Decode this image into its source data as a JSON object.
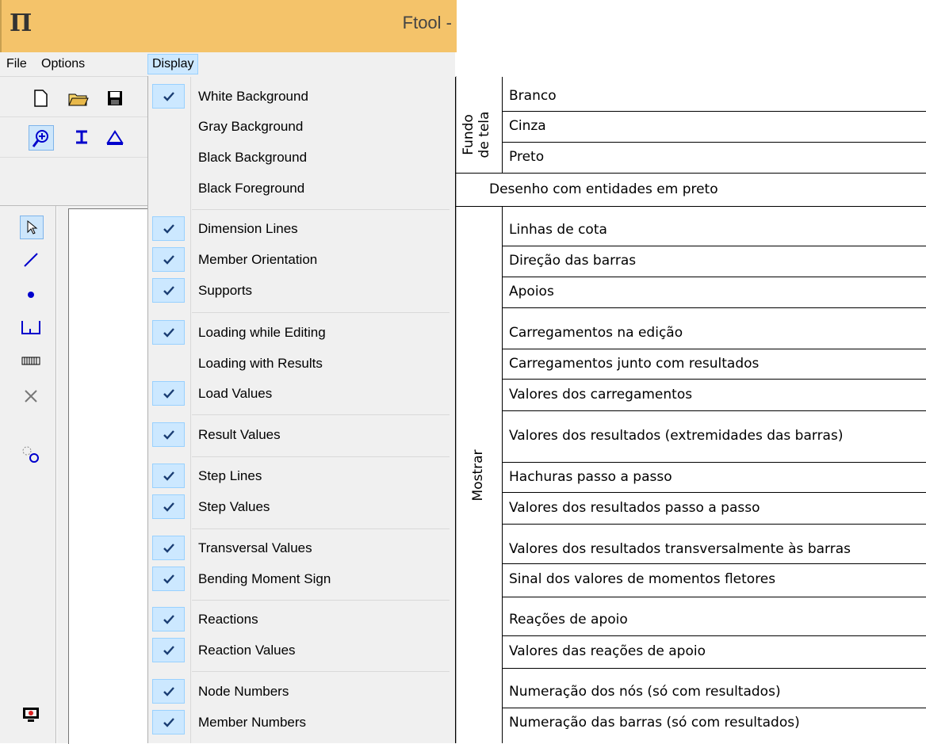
{
  "window": {
    "title": "Ftool -"
  },
  "menubar": {
    "file": "File",
    "options": "Options",
    "display": "Display"
  },
  "display_menu": {
    "items": [
      {
        "label": "White Background",
        "checked": true
      },
      {
        "label": "Gray Background",
        "checked": false
      },
      {
        "label": "Black Background",
        "checked": false
      },
      {
        "label": "Black Foreground",
        "checked": false
      },
      {
        "label": "Dimension Lines",
        "checked": true
      },
      {
        "label": "Member Orientation",
        "checked": true
      },
      {
        "label": "Supports",
        "checked": true
      },
      {
        "label": "Loading while Editing",
        "checked": true
      },
      {
        "label": "Loading with Results",
        "checked": false
      },
      {
        "label": "Load Values",
        "checked": true
      },
      {
        "label": "Result Values",
        "checked": true
      },
      {
        "label": "Step Lines",
        "checked": true
      },
      {
        "label": "Step Values",
        "checked": true
      },
      {
        "label": "Transversal Values",
        "checked": true
      },
      {
        "label": "Bending Moment Sign",
        "checked": true
      },
      {
        "label": "Reactions",
        "checked": true
      },
      {
        "label": "Reaction Values",
        "checked": true
      },
      {
        "label": "Node Numbers",
        "checked": true
      },
      {
        "label": "Member Numbers",
        "checked": true
      }
    ]
  },
  "annotation": {
    "group_background_line1": "Fundo",
    "group_background_line2": "de tela",
    "group_show": "Mostrar",
    "rows": [
      "Branco",
      "Cinza",
      "Preto",
      "Desenho com entidades em preto",
      "Linhas de cota",
      "Direção das barras",
      "Apoios",
      "Carregamentos na edição",
      "Carregamentos junto com resultados",
      "Valores dos carregamentos",
      "Valores dos resultados (extremidades das barras)",
      "Hachuras passo a passo",
      "Valores dos resultados passo a passo",
      "Valores dos resultados transversalmente às barras",
      "Sinal dos valores de momentos fletores",
      "Reações de apoio",
      "Valores das reações de apoio",
      "Numeração dos nós (só com resultados)",
      "Numeração das barras (só com resultados)"
    ]
  },
  "icons": {
    "app": "ftool-logo-icon",
    "toolbar": [
      "new-file-icon",
      "open-folder-icon",
      "save-icon",
      "zoom-fit-icon",
      "beam-icon",
      "triangle-icon"
    ],
    "left_tools": [
      "select-arrow-icon",
      "line-icon",
      "node-icon",
      "support-icon",
      "hatch-icon",
      "delete-icon",
      "snap-icon",
      "display-icon"
    ]
  }
}
